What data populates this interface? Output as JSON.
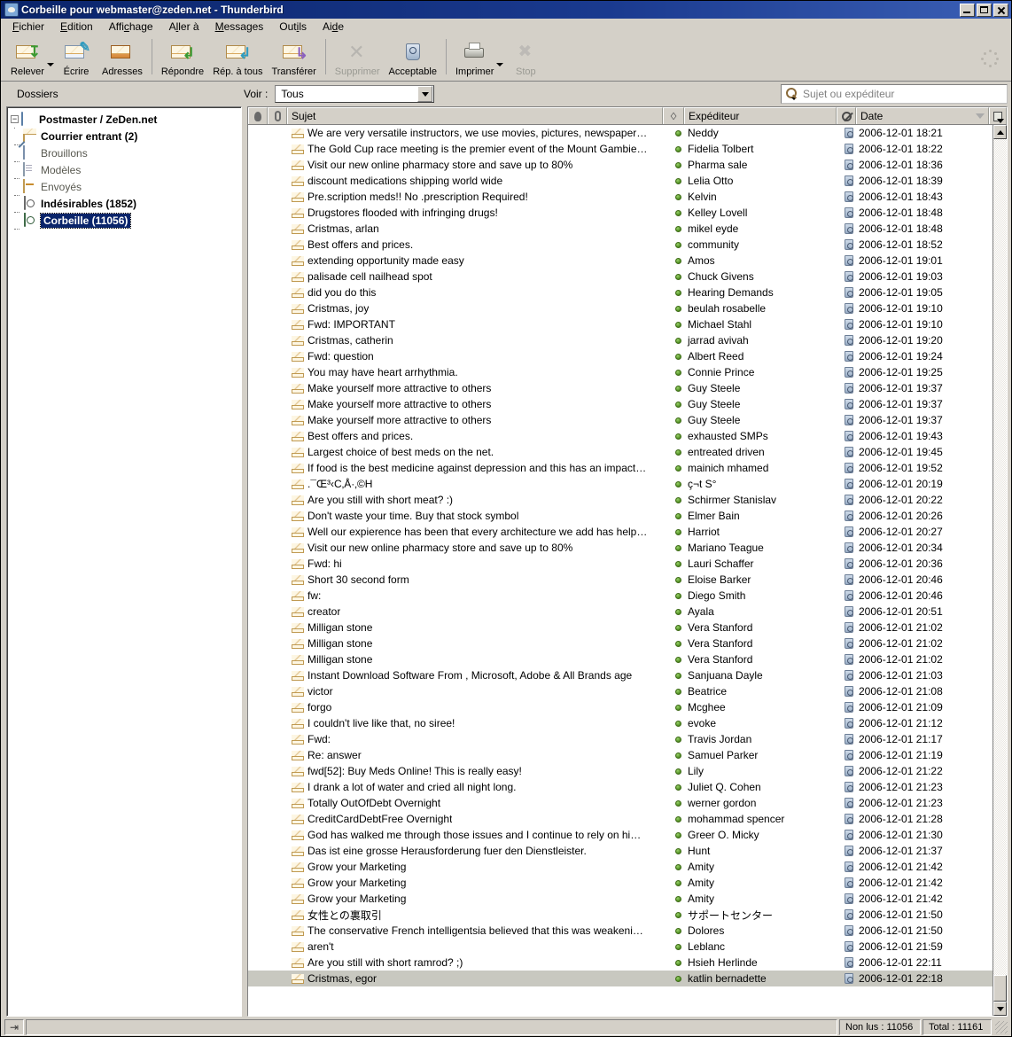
{
  "window": {
    "title": "Corbeille pour webmaster@zeden.net - Thunderbird",
    "app_icon": "thunderbird-icon",
    "minimize_label": "Minimiser",
    "maximize_label": "Agrandir",
    "close_label": "Fermer"
  },
  "menubar": [
    {
      "label": "Fichier",
      "accel": "F"
    },
    {
      "label": "Edition",
      "accel": "E"
    },
    {
      "label": "Affichage",
      "accel": "c"
    },
    {
      "label": "Aller à",
      "accel": "l"
    },
    {
      "label": "Messages",
      "accel": "M"
    },
    {
      "label": "Outils",
      "accel": "i"
    },
    {
      "label": "Aide",
      "accel": "d"
    }
  ],
  "toolbar": {
    "buttons": [
      {
        "label": "Relever",
        "icon": "get-mail-icon",
        "dropdown": true,
        "disabled": false
      },
      {
        "label": "Écrire",
        "icon": "compose-icon",
        "dropdown": false,
        "disabled": false
      },
      {
        "label": "Adresses",
        "icon": "address-book-icon",
        "dropdown": false,
        "disabled": false
      },
      {
        "label": "Répondre",
        "icon": "reply-icon",
        "dropdown": false,
        "disabled": false
      },
      {
        "label": "Rép. à tous",
        "icon": "reply-all-icon",
        "dropdown": false,
        "disabled": false
      },
      {
        "label": "Transférer",
        "icon": "forward-icon",
        "dropdown": false,
        "disabled": false
      },
      {
        "label": "Supprimer",
        "icon": "delete-icon",
        "dropdown": false,
        "disabled": true
      },
      {
        "label": "Acceptable",
        "icon": "not-junk-icon",
        "dropdown": false,
        "disabled": false
      },
      {
        "label": "Imprimer",
        "icon": "print-icon",
        "dropdown": true,
        "disabled": false
      },
      {
        "label": "Stop",
        "icon": "stop-icon",
        "dropdown": false,
        "disabled": true
      }
    ],
    "throbber": "activity-indicator"
  },
  "folderpane": {
    "header": "Dossiers",
    "items": [
      {
        "label": "Postmaster / ZeDen.net",
        "icon": "account-icon",
        "level": 0,
        "bold": true,
        "selected": false,
        "twisty": "−"
      },
      {
        "label": "Courrier entrant (2)",
        "icon": "inbox-icon",
        "level": 1,
        "bold": true,
        "selected": false
      },
      {
        "label": "Brouillons",
        "icon": "drafts-icon",
        "level": 1,
        "bold": false,
        "selected": false
      },
      {
        "label": "Modèles",
        "icon": "templates-icon",
        "level": 1,
        "bold": false,
        "selected": false
      },
      {
        "label": "Envoyés",
        "icon": "sent-icon",
        "level": 1,
        "bold": false,
        "selected": false
      },
      {
        "label": "Indésirables (1852)",
        "icon": "junk-icon",
        "level": 1,
        "bold": true,
        "selected": false
      },
      {
        "label": "Corbeille (11056)",
        "icon": "trash-icon",
        "level": 1,
        "bold": true,
        "selected": true
      }
    ]
  },
  "filterbar": {
    "view_label": "Voir :",
    "view_value": "Tous",
    "view_options": [
      "Tous"
    ],
    "search_placeholder": "Sujet ou expéditeur",
    "search_value": "",
    "search_icon": "search-icon"
  },
  "messagelist": {
    "columns": {
      "thread": "thread-column-icon",
      "attachment": "attachment-column-icon",
      "subject": "Sujet",
      "flag": "flag-column-icon",
      "sender": "Expéditeur",
      "junk": "junk-column-icon",
      "date": "Date",
      "date_sort": "descending",
      "picker": "column-picker-icon"
    },
    "rows": [
      {
        "subject": "We are very versatile instructors, we use movies, pictures, newspaper arti...",
        "sender": "Neddy",
        "date": "2006-12-01 18:21"
      },
      {
        "subject": "The Gold Cup race meeting is the premier event of the Mount Gambier Ra...",
        "sender": "Fidelia Tolbert",
        "date": "2006-12-01 18:22"
      },
      {
        "subject": "Visit our new online pharmacy store and save up to 80%",
        "sender": "Pharma sale",
        "date": "2006-12-01 18:36"
      },
      {
        "subject": "discount medications shipping world wide",
        "sender": "Lelia Otto",
        "date": "2006-12-01 18:39"
      },
      {
        "subject": "Pre.scription meds!! No .prescription Required!",
        "sender": "Kelvin",
        "date": "2006-12-01 18:43"
      },
      {
        "subject": "Drugstores flooded with infringing drugs!",
        "sender": "Kelley Lovell",
        "date": "2006-12-01 18:48"
      },
      {
        "subject": "Cristmas, arlan",
        "sender": "mikel eyde",
        "date": "2006-12-01 18:48"
      },
      {
        "subject": "Best offers and prices.",
        "sender": "community",
        "date": "2006-12-01 18:52"
      },
      {
        "subject": "extending opportunity made easy",
        "sender": "Amos",
        "date": "2006-12-01 19:01"
      },
      {
        "subject": "palisade cell nailhead spot",
        "sender": "Chuck Givens",
        "date": "2006-12-01 19:03"
      },
      {
        "subject": "did you do this",
        "sender": "Hearing Demands",
        "date": "2006-12-01 19:05"
      },
      {
        "subject": "Cristmas, joy",
        "sender": "beulah rosabelle",
        "date": "2006-12-01 19:10"
      },
      {
        "subject": "Fwd: IMPORTANT",
        "sender": "Michael Stahl",
        "date": "2006-12-01 19:10"
      },
      {
        "subject": "Cristmas, catherin",
        "sender": "jarrad avivah",
        "date": "2006-12-01 19:20"
      },
      {
        "subject": "Fwd: question",
        "sender": "Albert Reed",
        "date": "2006-12-01 19:24"
      },
      {
        "subject": "You may have heart arrhythmia.",
        "sender": "Connie Prince",
        "date": "2006-12-01 19:25"
      },
      {
        "subject": "Make yourself more attractive to others",
        "sender": "Guy Steele",
        "date": "2006-12-01 19:37"
      },
      {
        "subject": "Make yourself more attractive to others",
        "sender": "Guy Steele",
        "date": "2006-12-01 19:37"
      },
      {
        "subject": "Make yourself more attractive to others",
        "sender": "Guy Steele",
        "date": "2006-12-01 19:37"
      },
      {
        "subject": "Best offers and prices.",
        "sender": "exhausted SMPs",
        "date": "2006-12-01 19:43"
      },
      {
        "subject": "Largest choice of best meds on the net.",
        "sender": "entreated driven",
        "date": "2006-12-01 19:45"
      },
      {
        "subject": "If food is the best medicine against depression and this has an impact on ...",
        "sender": "mainich mhamed",
        "date": "2006-12-01 19:52"
      },
      {
        "subject": ".¯Œ³‹C‚Å·‚©H",
        "sender": "ç¬t S°",
        "date": "2006-12-01 20:19"
      },
      {
        "subject": "Are you still with short meat? :)",
        "sender": "Schirmer Stanislav",
        "date": "2006-12-01 20:22"
      },
      {
        "subject": "Don't waste your time. Buy that stock symbol",
        "sender": "Elmer Bain",
        "date": "2006-12-01 20:26"
      },
      {
        "subject": "Well our expierence has been that every architecture we add has helped ...",
        "sender": "Harriot",
        "date": "2006-12-01 20:27"
      },
      {
        "subject": "Visit our new online pharmacy store and save up to 80%",
        "sender": "Mariano Teague",
        "date": "2006-12-01 20:34"
      },
      {
        "subject": "Fwd: hi",
        "sender": "Lauri Schaffer",
        "date": "2006-12-01 20:36"
      },
      {
        "subject": "Short 30 second form",
        "sender": "Eloise Barker",
        "date": "2006-12-01 20:46"
      },
      {
        "subject": "fw:",
        "sender": "Diego Smith",
        "date": "2006-12-01 20:46"
      },
      {
        "subject": "creator",
        "sender": "Ayala",
        "date": "2006-12-01 20:51"
      },
      {
        "subject": "Milligan stone",
        "sender": "Vera Stanford",
        "date": "2006-12-01 21:02"
      },
      {
        "subject": "Milligan stone",
        "sender": "Vera Stanford",
        "date": "2006-12-01 21:02"
      },
      {
        "subject": "Milligan stone",
        "sender": "Vera Stanford",
        "date": "2006-12-01 21:02"
      },
      {
        "subject": "Instant Download Software From , Microsoft, Adobe & All Brands age",
        "sender": "Sanjuana Dayle",
        "date": "2006-12-01 21:03"
      },
      {
        "subject": "victor",
        "sender": "Beatrice",
        "date": "2006-12-01 21:08"
      },
      {
        "subject": "forgo",
        "sender": "Mcghee",
        "date": "2006-12-01 21:09"
      },
      {
        "subject": "I couldn't live like that, no siree!",
        "sender": "evoke",
        "date": "2006-12-01 21:12"
      },
      {
        "subject": "Fwd:",
        "sender": "Travis Jordan",
        "date": "2006-12-01 21:17"
      },
      {
        "subject": "Re: answer",
        "sender": "Samuel Parker",
        "date": "2006-12-01 21:19"
      },
      {
        "subject": "fwd[52]: Buy Meds Online! This is really easy!",
        "sender": "Lily",
        "date": "2006-12-01 21:22"
      },
      {
        "subject": "I drank a lot of water and cried all night long.",
        "sender": "Juliet Q. Cohen",
        "date": "2006-12-01 21:23"
      },
      {
        "subject": "Totally OutOfDebt Overnight",
        "sender": "werner gordon",
        "date": "2006-12-01 21:23"
      },
      {
        "subject": "CreditCardDebtFree Overnight",
        "sender": "mohammad spencer",
        "date": "2006-12-01 21:28"
      },
      {
        "subject": "God has walked me through those issues and I continue to rely on him for...",
        "sender": "Greer O. Micky",
        "date": "2006-12-01 21:30"
      },
      {
        "subject": "Das ist eine grosse Herausforderung fuer den Dienstleister.",
        "sender": "Hunt",
        "date": "2006-12-01 21:37"
      },
      {
        "subject": "Grow your Marketing",
        "sender": "Amity",
        "date": "2006-12-01 21:42"
      },
      {
        "subject": "Grow your Marketing",
        "sender": "Amity",
        "date": "2006-12-01 21:42"
      },
      {
        "subject": "Grow your Marketing",
        "sender": "Amity",
        "date": "2006-12-01 21:42"
      },
      {
        "subject": "女性との裏取引",
        "sender": "サポートセンター",
        "date": "2006-12-01 21:50"
      },
      {
        "subject": "The conservative French intelligentsia believed that this was weakening t...",
        "sender": "Dolores",
        "date": "2006-12-01 21:50"
      },
      {
        "subject": "aren't",
        "sender": "Leblanc",
        "date": "2006-12-01 21:59"
      },
      {
        "subject": "Are you still with short ramrod? ;)",
        "sender": "Hsieh Herlinde",
        "date": "2006-12-01 22:11"
      },
      {
        "subject": "Cristmas, egor",
        "sender": "katlin bernadette",
        "date": "2006-12-01 22:18",
        "selected": true
      }
    ]
  },
  "statusbar": {
    "offline_icon": "offline-status-icon",
    "message": "",
    "unread": "Non lus : 11056",
    "total": "Total : 11161"
  },
  "colors": {
    "titlebar_start": "#0a246a",
    "chrome": "#d4d0c8",
    "selection": "#0a246a",
    "row_selected": "#c8c8c0",
    "unread_dot": "#4e8c22"
  }
}
